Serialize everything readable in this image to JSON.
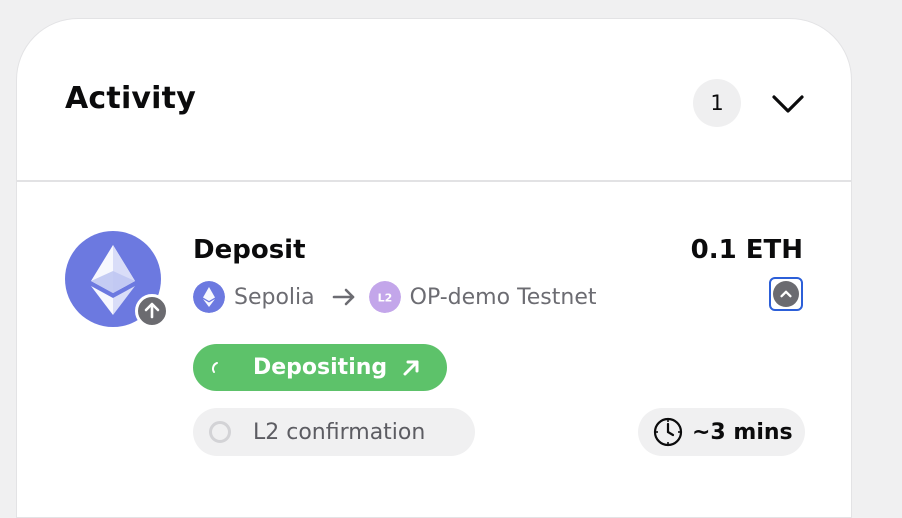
{
  "activity": {
    "title": "Activity",
    "count": "1"
  },
  "transaction": {
    "type": "Deposit",
    "amount": "0.1 ETH",
    "from_network": "Sepolia",
    "to_network": "OP-demo Testnet",
    "to_network_icon_text": "L2",
    "status": "Depositing",
    "step": "L2 confirmation",
    "eta": "~3 mins"
  },
  "icons": {
    "token": "ethereum-icon",
    "direction": "arrow-up-icon",
    "route": "arrow-right-icon",
    "collapse": "chevron-up-icon",
    "status": "external-link-icon",
    "eta": "clock-icon"
  },
  "colors": {
    "status_green": "#5dc26a",
    "eth_purple": "#6c79e0",
    "l2_lavender": "#c3a6ea",
    "focus_blue": "#2c5fd8"
  }
}
